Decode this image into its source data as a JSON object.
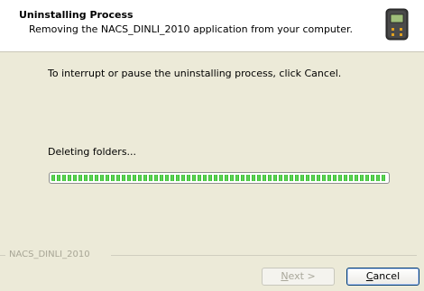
{
  "header": {
    "title": "Uninstalling Process",
    "subtitle": "Removing the NACS_DINLI_2010 application from your computer.",
    "icon": "device-icon"
  },
  "body": {
    "instruction": "To interrupt or pause the uninstalling process, click Cancel.",
    "status": "Deleting folders...",
    "progress_fraction": 1.0
  },
  "footer": {
    "brand": "NACS_DINLI_2010",
    "next": {
      "accel": "N",
      "rest": "ext >",
      "enabled": false
    },
    "cancel": {
      "accel": "C",
      "rest": "ancel",
      "enabled": true
    }
  },
  "colors": {
    "background": "#ecead8",
    "progress_green": "#2ab326",
    "cancel_border": "#003c74"
  }
}
